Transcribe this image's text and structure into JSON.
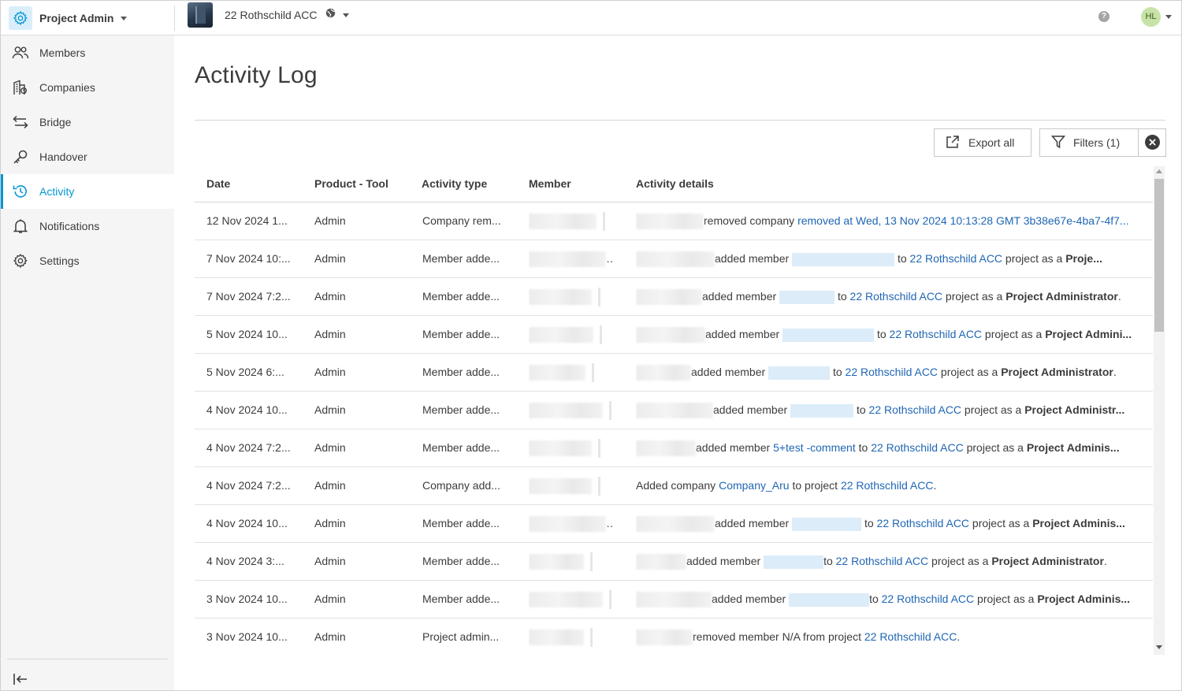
{
  "app": {
    "title": "Project Admin",
    "icon": "gear-icon"
  },
  "project": {
    "name": "22 Rothschild ACC",
    "icon": "globe-icon"
  },
  "user": {
    "initials": "HL",
    "avatar_color": "#c8e3a8"
  },
  "help": {
    "label": "?"
  },
  "colors": {
    "accent": "#0696d7",
    "link": "#1f66b3",
    "sidebar_bg": "#f5f5f5"
  },
  "sidebar": {
    "items": [
      {
        "label": "Members",
        "icon": "people-icon",
        "active": false
      },
      {
        "label": "Companies",
        "icon": "building-icon",
        "active": false
      },
      {
        "label": "Bridge",
        "icon": "arrows-exchange-icon",
        "active": false
      },
      {
        "label": "Handover",
        "icon": "key-icon",
        "active": false
      },
      {
        "label": "Activity",
        "icon": "history-icon",
        "active": true
      },
      {
        "label": "Notifications",
        "icon": "bell-icon",
        "active": false
      },
      {
        "label": "Settings",
        "icon": "gear-icon",
        "active": false
      }
    ],
    "collapse_icon": "collapse-left-icon"
  },
  "page": {
    "title": "Activity Log"
  },
  "toolbar": {
    "export_label": "Export all",
    "filters_label": "Filters (1)",
    "clear_icon": "close-circle-icon"
  },
  "table": {
    "columns": [
      "Date",
      "Product - Tool",
      "Activity type",
      "Member",
      "Activity details"
    ],
    "rows": [
      {
        "date": "12 Nov 2024 1...",
        "product": "Admin",
        "type": "Company rem...",
        "details": [
          {
            "t": "text",
            "v": "removed company "
          },
          {
            "t": "link",
            "v": "removed at Wed, 13 Nov 2024 10:13:28 GMT 3b38e67e-4ba7-4f7..."
          }
        ]
      },
      {
        "date": "7 Nov 2024 10:...",
        "product": "Admin",
        "type": "Member adde...",
        "details": [
          {
            "t": "text",
            "v": "added member "
          },
          {
            "t": "hidden"
          },
          {
            "t": "text",
            "v": " to "
          },
          {
            "t": "link",
            "v": "22 Rothschild ACC"
          },
          {
            "t": "text",
            "v": " project as a "
          },
          {
            "t": "bold",
            "v": "Proje..."
          }
        ]
      },
      {
        "date": "7 Nov 2024 7:2...",
        "product": "Admin",
        "type": "Member adde...",
        "details": [
          {
            "t": "text",
            "v": "added member "
          },
          {
            "t": "hidden"
          },
          {
            "t": "text",
            "v": " to "
          },
          {
            "t": "link",
            "v": "22 Rothschild ACC"
          },
          {
            "t": "text",
            "v": " project as a "
          },
          {
            "t": "bold",
            "v": "Project Administrator"
          },
          {
            "t": "text",
            "v": "."
          }
        ]
      },
      {
        "date": "5 Nov 2024 10...",
        "product": "Admin",
        "type": "Member adde...",
        "details": [
          {
            "t": "text",
            "v": "added member "
          },
          {
            "t": "hidden"
          },
          {
            "t": "text",
            "v": " to "
          },
          {
            "t": "link",
            "v": "22 Rothschild ACC"
          },
          {
            "t": "text",
            "v": " project as a "
          },
          {
            "t": "bold",
            "v": "Project Admini..."
          }
        ]
      },
      {
        "date": "5 Nov 2024 6:...",
        "product": "Admin",
        "type": "Member adde...",
        "details": [
          {
            "t": "text",
            "v": "added member "
          },
          {
            "t": "hidden"
          },
          {
            "t": "text",
            "v": " to "
          },
          {
            "t": "link",
            "v": "22 Rothschild ACC"
          },
          {
            "t": "text",
            "v": " project as a "
          },
          {
            "t": "bold",
            "v": "Project Administrator"
          },
          {
            "t": "text",
            "v": "."
          }
        ]
      },
      {
        "date": "4 Nov 2024 10...",
        "product": "Admin",
        "type": "Member adde...",
        "details": [
          {
            "t": "text",
            "v": "added member "
          },
          {
            "t": "hidden"
          },
          {
            "t": "text",
            "v": " to "
          },
          {
            "t": "link",
            "v": "22 Rothschild ACC"
          },
          {
            "t": "text",
            "v": " project as a "
          },
          {
            "t": "bold",
            "v": "Project Administr..."
          }
        ]
      },
      {
        "date": "4 Nov 2024 7:2...",
        "product": "Admin",
        "type": "Member adde...",
        "details": [
          {
            "t": "text",
            "v": "added member "
          },
          {
            "t": "link",
            "v": "5+test -comment"
          },
          {
            "t": "text",
            "v": " to "
          },
          {
            "t": "link",
            "v": "22 Rothschild ACC"
          },
          {
            "t": "text",
            "v": " project as a "
          },
          {
            "t": "bold",
            "v": "Project Adminis..."
          }
        ]
      },
      {
        "date": "4 Nov 2024 7:2...",
        "product": "Admin",
        "type": "Company add...",
        "noActor": true,
        "details": [
          {
            "t": "text",
            "v": "Added company "
          },
          {
            "t": "link",
            "v": "Company_Aru"
          },
          {
            "t": "text",
            "v": " to project "
          },
          {
            "t": "link",
            "v": "22 Rothschild ACC"
          },
          {
            "t": "text",
            "v": "."
          }
        ]
      },
      {
        "date": "4 Nov 2024 10...",
        "product": "Admin",
        "type": "Member adde...",
        "details": [
          {
            "t": "text",
            "v": "added member "
          },
          {
            "t": "hidden"
          },
          {
            "t": "text",
            "v": " to "
          },
          {
            "t": "link",
            "v": "22 Rothschild ACC"
          },
          {
            "t": "text",
            "v": " project as a "
          },
          {
            "t": "bold",
            "v": "Project Adminis..."
          }
        ]
      },
      {
        "date": "4 Nov 2024 3:...",
        "product": "Admin",
        "type": "Member adde...",
        "details": [
          {
            "t": "text",
            "v": "added member "
          },
          {
            "t": "hidden"
          },
          {
            "t": "text",
            "v": "to "
          },
          {
            "t": "link",
            "v": "22 Rothschild ACC"
          },
          {
            "t": "text",
            "v": " project as a "
          },
          {
            "t": "bold",
            "v": "Project Administrator"
          },
          {
            "t": "text",
            "v": "."
          }
        ]
      },
      {
        "date": "3 Nov 2024 10...",
        "product": "Admin",
        "type": "Member adde...",
        "details": [
          {
            "t": "text",
            "v": "added member "
          },
          {
            "t": "hidden"
          },
          {
            "t": "text",
            "v": "to "
          },
          {
            "t": "link",
            "v": "22 Rothschild ACC"
          },
          {
            "t": "text",
            "v": " project as a "
          },
          {
            "t": "bold",
            "v": "Project Adminis..."
          }
        ]
      },
      {
        "date": "3 Nov 2024 10...",
        "product": "Admin",
        "type": "Project admin...",
        "details": [
          {
            "t": "text",
            "v": "removed member N/A from project "
          },
          {
            "t": "link",
            "v": "22 Rothschild ACC"
          },
          {
            "t": "text",
            "v": "."
          }
        ]
      }
    ]
  }
}
